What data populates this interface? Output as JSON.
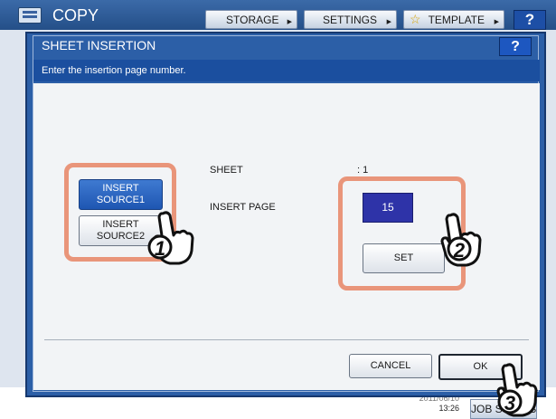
{
  "app": {
    "title": "COPY",
    "top_buttons": [
      {
        "label": "STORAGE"
      },
      {
        "label": "SETTINGS"
      },
      {
        "label": "TEMPLATE"
      }
    ],
    "help_label": "?",
    "datetime_date": "2011/06/10",
    "datetime_time": "13:26",
    "job_status_label": "JOB STATUS"
  },
  "dialog": {
    "title": "SHEET INSERTION",
    "help_label": "?",
    "instruction": "Enter the insertion page number.",
    "source_buttons": [
      {
        "line1": "INSERT",
        "line2": "SOURCE1",
        "selected": true
      },
      {
        "line1": "INSERT",
        "line2": "SOURCE2",
        "selected": false
      }
    ],
    "sheet_label": "SHEET",
    "sheet_value": ": 1",
    "insert_page_label": "INSERT PAGE",
    "insert_page_value": "15",
    "set_label": "SET",
    "cancel_label": "CANCEL",
    "ok_label": "OK"
  },
  "callouts": [
    "1",
    "2",
    "3"
  ],
  "colors": {
    "title_bar": "#2c5fa7",
    "instruction_bar": "#1b4f9f",
    "selected_button": "#1e56b2",
    "page_field": "#2e33a8",
    "callout": "#e9957a"
  }
}
